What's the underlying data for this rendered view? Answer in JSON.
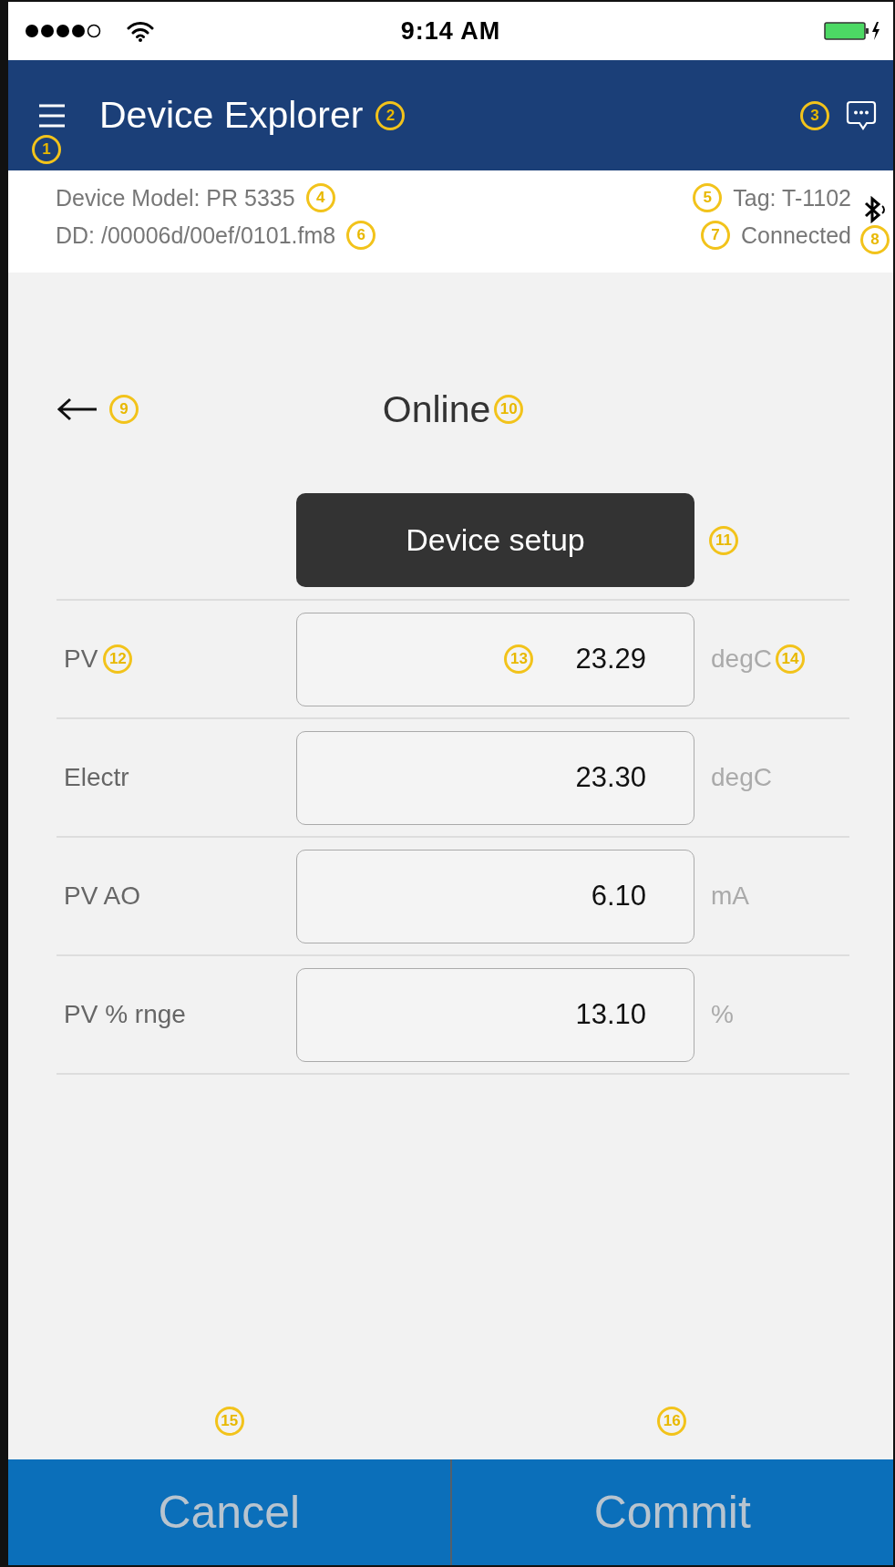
{
  "status_bar": {
    "time": "9:14 AM"
  },
  "header": {
    "title": "Device Explorer",
    "menu_callout": "1",
    "title_callout": "2",
    "chat_callout": "3"
  },
  "info": {
    "model": {
      "text": "Device Model:  PR 5335",
      "callout": "4"
    },
    "dd": {
      "text": "DD:  /00006d/00ef/0101.fm8",
      "callout": "6"
    },
    "tag": {
      "text": "Tag:  T-1102",
      "callout": "5"
    },
    "connection": {
      "text": "Connected",
      "callout": "7"
    },
    "bluetooth_callout": "8"
  },
  "page": {
    "back_callout": "9",
    "title": "Online",
    "title_callout": "10",
    "section_button": {
      "label": "Device setup",
      "callout": "11"
    }
  },
  "rows": [
    {
      "label": "PV",
      "label_callout": "12",
      "value": "23.29",
      "value_callout": "13",
      "unit": "degC",
      "unit_callout": "14"
    },
    {
      "label": "Electr",
      "value": "23.30",
      "unit": "degC"
    },
    {
      "label": "PV AO",
      "value": "6.10",
      "unit": "mA"
    },
    {
      "label": "PV % rnge",
      "value": "13.10",
      "unit": "%"
    }
  ],
  "footer": {
    "callouts": [
      "15",
      "16"
    ],
    "buttons": [
      {
        "label": "Cancel"
      },
      {
        "label": "Commit"
      }
    ]
  }
}
